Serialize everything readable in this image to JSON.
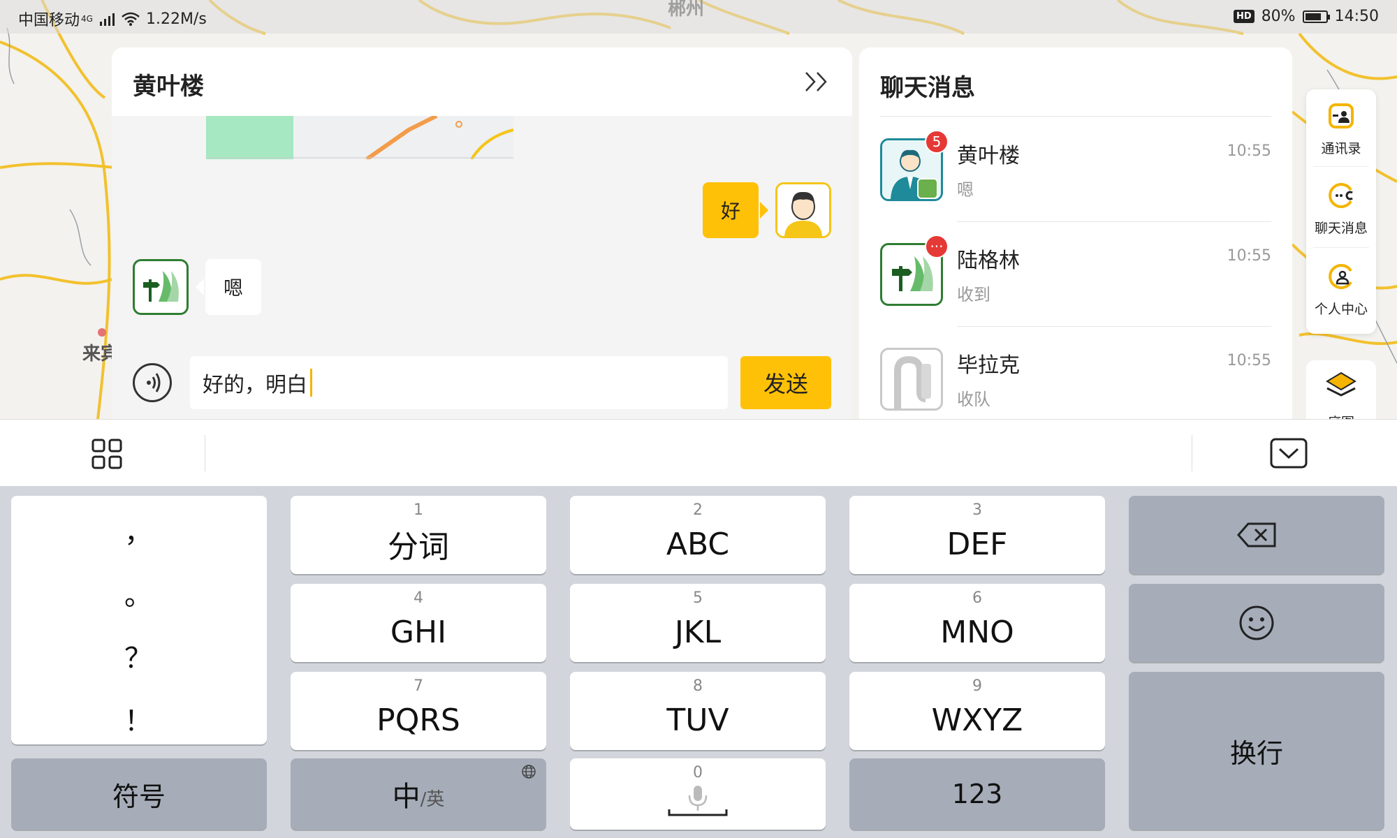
{
  "status_bar": {
    "carrier": "中国移动",
    "network": "4G",
    "speed": "1.22M/s",
    "hd": "HD",
    "battery": "80%",
    "battery_level": 0.8,
    "time": "14:50"
  },
  "map": {
    "labels": [
      "郴州",
      "来宾"
    ]
  },
  "chat": {
    "title": "黄叶楼",
    "self_message": "好",
    "other_message": "嗯",
    "input_value": "好的，明白",
    "send_label": "发送"
  },
  "conversations": {
    "title": "聊天消息",
    "items": [
      {
        "name": "黄叶楼",
        "preview": "嗯",
        "time": "10:55",
        "badge": "5"
      },
      {
        "name": "陆格林",
        "preview": "收到",
        "time": "10:55",
        "badge": "···"
      },
      {
        "name": "毕拉克",
        "preview": "收队",
        "time": "10:55",
        "badge": ""
      }
    ]
  },
  "side_menu": {
    "items": [
      {
        "label": "通讯录",
        "icon": "contacts-icon"
      },
      {
        "label": "聊天消息",
        "icon": "chat-icon"
      },
      {
        "label": "个人中心",
        "icon": "profile-icon"
      }
    ],
    "layers_label": "底图"
  },
  "keyboard": {
    "punctuation": [
      "，",
      "。",
      "？",
      "！"
    ],
    "keys": [
      {
        "num": "1",
        "label": "分词"
      },
      {
        "num": "2",
        "label": "ABC"
      },
      {
        "num": "3",
        "label": "DEF"
      },
      {
        "num": "4",
        "label": "GHI"
      },
      {
        "num": "5",
        "label": "JKL"
      },
      {
        "num": "6",
        "label": "MNO"
      },
      {
        "num": "7",
        "label": "PQRS"
      },
      {
        "num": "8",
        "label": "TUV"
      },
      {
        "num": "9",
        "label": "WXYZ"
      }
    ],
    "symbols_label": "符号",
    "lang_main": "中",
    "lang_sub": "/英",
    "space_num": "0",
    "numbers_label": "123",
    "enter_label": "换行"
  },
  "colors": {
    "accent": "#ffc107",
    "badge": "#e53935",
    "avatar_green": "#2e7d32"
  }
}
